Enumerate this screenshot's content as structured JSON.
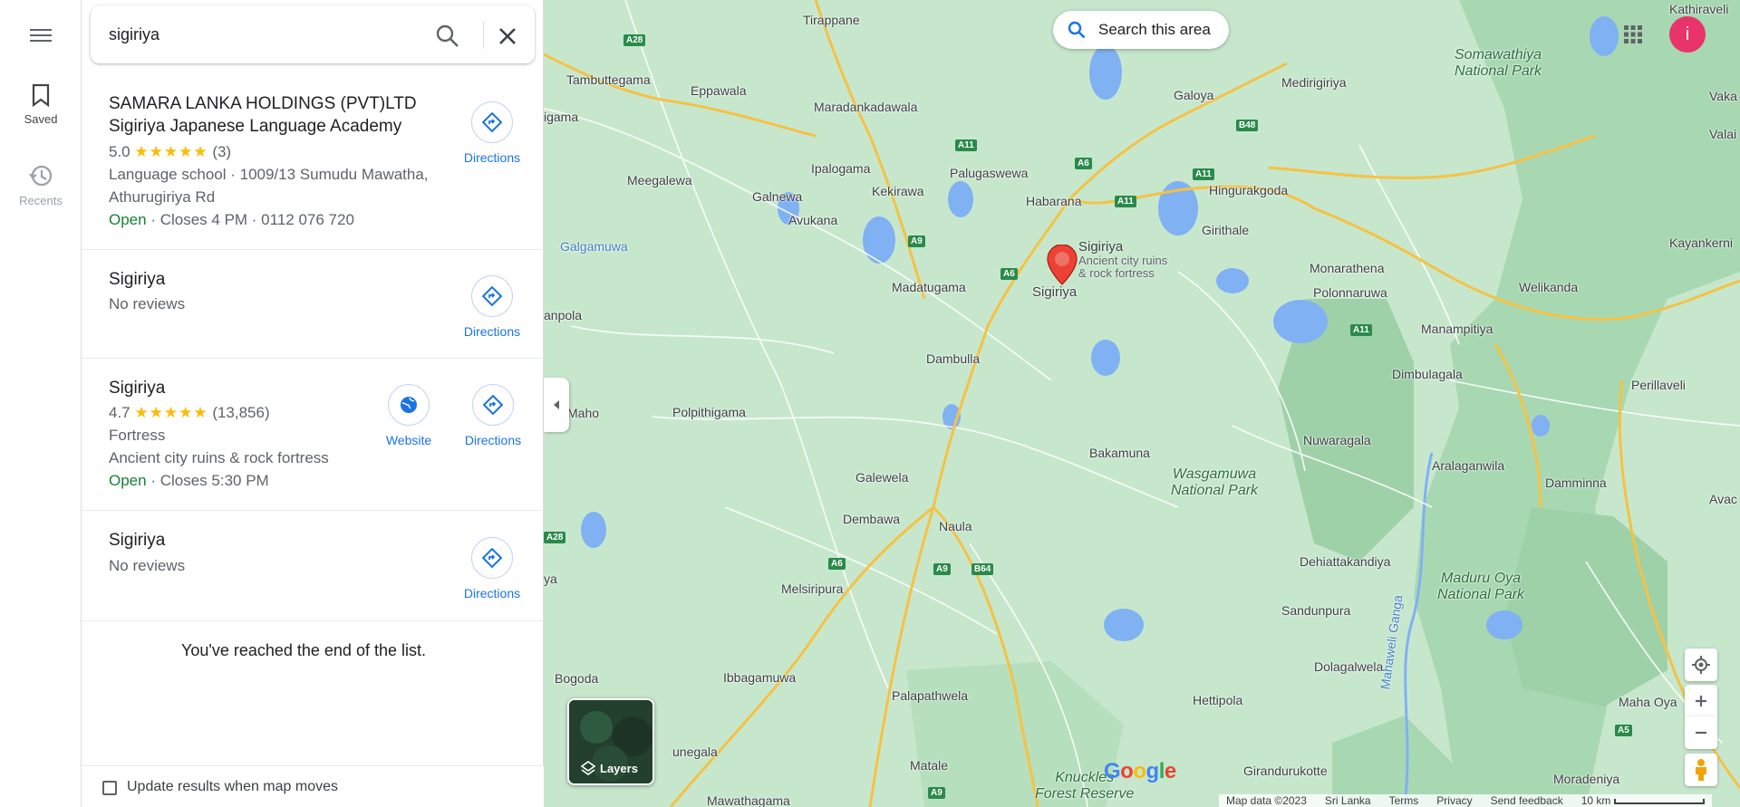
{
  "rail": {
    "saved_label": "Saved",
    "recents_label": "Recents"
  },
  "search": {
    "query": "sigiriya"
  },
  "results": [
    {
      "title_line1": "SAMARA LANKA HOLDINGS (PVT)LTD",
      "title_line2": "Sigiriya Japanese Language Academy",
      "rating": "5.0",
      "stars": "★★★★★",
      "review_count": "(3)",
      "detail1": "Language school · 1009/13 Sumudu Mawatha,",
      "detail2": "Athurugiriya Rd",
      "open": "Open",
      "hours": " · Closes 4 PM · 0112 076 720",
      "directions": "Directions"
    },
    {
      "title": "Sigiriya",
      "reviews": "No reviews",
      "directions": "Directions"
    },
    {
      "title": "Sigiriya",
      "rating": "4.7",
      "stars": "★★★★★",
      "review_count": "(13,856)",
      "category": "Fortress",
      "description": "Ancient city ruins & rock fortress",
      "open": "Open",
      "hours": " · Closes 5:30 PM",
      "website": "Website",
      "directions": "Directions"
    },
    {
      "title": "Sigiriya",
      "reviews": "No reviews",
      "directions": "Directions"
    }
  ],
  "end_of_list": "You've reached the end of the list.",
  "update_results": "Update results when map moves",
  "map": {
    "search_area": "Search this area",
    "avatar_letter": "i",
    "layers_label": "Layers",
    "marker_title": "Sigiriya",
    "marker_sub1": "Ancient city ruins",
    "marker_sub2": "& rock fortress",
    "marker_name": "Sigiriya",
    "logo": "Google",
    "footer": {
      "map_data": "Map data ©2023",
      "country": "Sri Lanka",
      "terms": "Terms",
      "privacy": "Privacy",
      "feedback": "Send feedback",
      "scale": "10 km"
    },
    "places": [
      {
        "name": "Tirappane"
      },
      {
        "name": "Tambuttegama"
      },
      {
        "name": "Eppawala"
      },
      {
        "name": "Maradankadawala"
      },
      {
        "name": "Galoya"
      },
      {
        "name": "Medirigiriya"
      },
      {
        "name": "Ipalogama"
      },
      {
        "name": "Palugaswewa"
      },
      {
        "name": "Meegalewa"
      },
      {
        "name": "Galnewa"
      },
      {
        "name": "Kekirawa"
      },
      {
        "name": "Habarana"
      },
      {
        "name": "Hingurakgoda"
      },
      {
        "name": "Avukana"
      },
      {
        "name": "Girithale"
      },
      {
        "name": "Kayankerni"
      },
      {
        "name": "Galgamuwa"
      },
      {
        "name": "Madatugama"
      },
      {
        "name": "Monarathena"
      },
      {
        "name": "Polonnaruwa"
      },
      {
        "name": "Welikanda"
      },
      {
        "name": "anpola"
      },
      {
        "name": "Manampitiya"
      },
      {
        "name": "Dambulla"
      },
      {
        "name": "Dimbulagala"
      },
      {
        "name": "Maho"
      },
      {
        "name": "Polpithigama"
      },
      {
        "name": "Perillaveli"
      },
      {
        "name": "Nuwaragala"
      },
      {
        "name": "Bakamuna"
      },
      {
        "name": "Aralaganwila"
      },
      {
        "name": "Galewela"
      },
      {
        "name": "Damminna"
      },
      {
        "name": "Dembawa"
      },
      {
        "name": "Naula"
      },
      {
        "name": "Dehiattakandiya"
      },
      {
        "name": "Melsiripura"
      },
      {
        "name": "Sandunpura"
      },
      {
        "name": "Bogoda"
      },
      {
        "name": "Dolagalwela"
      },
      {
        "name": "Ibbagamuwa"
      },
      {
        "name": "Palapathwela"
      },
      {
        "name": "Hettipola"
      },
      {
        "name": "Maha Oya"
      },
      {
        "name": "unegala"
      },
      {
        "name": "Matale"
      },
      {
        "name": "Girandurukotte"
      },
      {
        "name": "Moradeniya"
      },
      {
        "name": "Mawathagama"
      },
      {
        "name": "Kathiraveli"
      },
      {
        "name": "Vaka"
      },
      {
        "name": "Valai"
      },
      {
        "name": "igama"
      },
      {
        "name": "ya"
      },
      {
        "name": "Avac"
      }
    ],
    "parks": [
      {
        "name1": "Somawathiya",
        "name2": "National Park"
      },
      {
        "name1": "Wasgamuwa",
        "name2": "National Park"
      },
      {
        "name1": "Maduru Oya",
        "name2": "National Park"
      },
      {
        "name1": "Knuckles",
        "name2": "Forest Reserve"
      }
    ],
    "river": "Mahaweli Ganga",
    "roads": [
      "A28",
      "A11",
      "A6",
      "B48",
      "A11",
      "A11",
      "A9",
      "A6",
      "A11",
      "A28",
      "A6",
      "A9",
      "B64",
      "A5",
      "A9"
    ]
  },
  "colors": {
    "accent": "#1a73e8",
    "open": "#188038",
    "star": "#fbbc04",
    "marker": "#ea4335",
    "avatar": "#e8336b"
  }
}
